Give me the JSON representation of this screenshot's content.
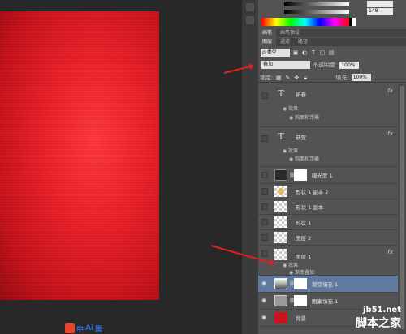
{
  "color_panel": {
    "value_1": "",
    "value_2": "148"
  },
  "tabs1": [
    "画笔",
    "画笔预设"
  ],
  "tabs2": [
    "图层",
    "通道",
    "路径"
  ],
  "filter": {
    "kind": "ρ 类型"
  },
  "blend": {
    "mode": "叠加",
    "opacity_label": "不透明度:",
    "opacity": "100%"
  },
  "lock": {
    "label": "锁定:",
    "fill_label": "填充:",
    "fill": "100%"
  },
  "layers": [
    {
      "name": "新春",
      "type": "text",
      "visible": false,
      "fx": "fx",
      "effects_label": "效果",
      "effects": [
        "斜面和浮雕"
      ]
    },
    {
      "name": "恭贺",
      "type": "text",
      "visible": false,
      "fx": "fx",
      "effects_label": "效果",
      "effects": [
        "斜面和浮雕"
      ]
    },
    {
      "name": "曝光度 1",
      "type": "adjustment",
      "visible": false
    },
    {
      "name": "形状 1 副本 2",
      "type": "shape-gold",
      "visible": false
    },
    {
      "name": "形状 1 副本",
      "type": "shape",
      "visible": false
    },
    {
      "name": "形状 1",
      "type": "shape",
      "visible": false
    },
    {
      "name": "图层 2",
      "type": "pixel",
      "visible": false
    },
    {
      "name": "图层 1",
      "type": "pixel",
      "visible": false,
      "fx": "fx",
      "effects_label": "效果",
      "effects": [
        "渐变叠加"
      ]
    },
    {
      "name": "渐变填充 1",
      "type": "gradient-fill",
      "visible": true,
      "selected": true
    },
    {
      "name": "图案填充 1",
      "type": "pattern-fill",
      "visible": true
    },
    {
      "name": "背景",
      "type": "background",
      "visible": true
    }
  ],
  "canvas_bottom": {
    "text1": "中",
    "text2": "Ai",
    "text3": "国"
  },
  "watermark": {
    "line1": "jb51.net",
    "line2": "脚本之家"
  },
  "colors": {
    "panel": "#535353",
    "selected": "#5f7a9e",
    "canvas": "#e8232b"
  }
}
